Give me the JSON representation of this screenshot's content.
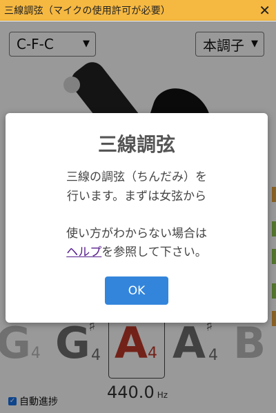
{
  "window": {
    "title": "三線調弦（マイクの使用許可が必要）",
    "close_label": "✕"
  },
  "controls": {
    "tuning_value": "C-F-C",
    "mode_value": "本調子"
  },
  "notes": [
    {
      "letter": "G",
      "octave": "4",
      "sharp": "",
      "color": "#bbbbbb"
    },
    {
      "letter": "G",
      "octave": "4",
      "sharp": "♯",
      "color": "#6e6e6e"
    },
    {
      "letter": "A",
      "octave": "4",
      "sharp": "",
      "color": "#c0392b"
    },
    {
      "letter": "A",
      "octave": "4",
      "sharp": "♯",
      "color": "#6e6e6e"
    },
    {
      "letter": "B",
      "octave": "",
      "sharp": "",
      "color": "#bbbbbb"
    }
  ],
  "frequency": {
    "value": "440.0",
    "unit": "Hz"
  },
  "auto_advance": {
    "label": "自動進捗",
    "checked": true
  },
  "dialog": {
    "title": "三線調弦",
    "line1": "三線の調弦（ちんだみ）を",
    "line2": "行います。まずは女弦から",
    "line3": "使い方がわからない場合は",
    "help_link": "ヘルプ",
    "line4_rest": "を参照して下さい。",
    "ok_label": "OK"
  },
  "colors": {
    "titlebar": "#f5b841",
    "accent": "#3385db",
    "highlight": "#c0392b"
  }
}
